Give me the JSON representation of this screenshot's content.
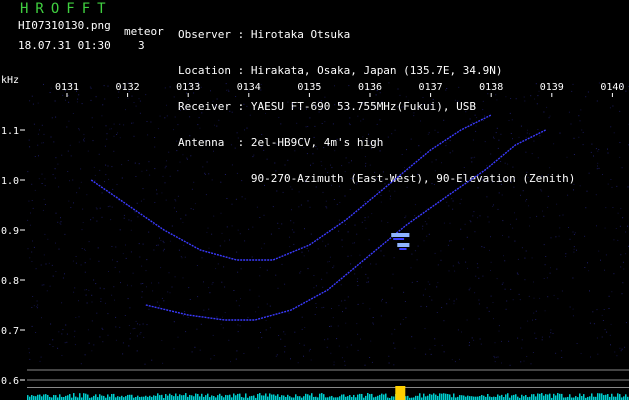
{
  "header": {
    "app_title": "HROFFT",
    "file_name": "HI07310130.png",
    "timestamp": "18.07.31 01:30",
    "meteor_label": "meteor",
    "meteor_count": "3",
    "info": [
      {
        "key": "Observer ",
        "value": "Hirotaka Otsuka"
      },
      {
        "key": "Location ",
        "value": "Hirakata, Osaka, Japan (135.7E, 34.9N)"
      },
      {
        "key": "Receiver ",
        "value": "YAESU FT-690 53.755MHz(Fukui), USB"
      },
      {
        "key": "Antenna  ",
        "value": "2el-HB9CV, 4m's high"
      },
      {
        "key": "",
        "value": "90-270-Azimuth (East-West), 90-Elevation (Zenith)"
      }
    ]
  },
  "colors": {
    "background": "#000000",
    "title": "#40d040",
    "signal": "#3a3aff",
    "signal_bright": "#8fb4ff",
    "noise_floor": "#00d0d0",
    "peak": "#ffd000",
    "grid_line": "#888888"
  },
  "chart_data": {
    "type": "heatmap",
    "ylabel": "kHz",
    "x_ticks": [
      "0131",
      "0132",
      "0133",
      "0134",
      "0135",
      "0136",
      "0137",
      "0138",
      "0139",
      "0140"
    ],
    "y_ticks": [
      "1.1",
      "1.0",
      "0.9",
      "0.8",
      "0.7",
      "0.6"
    ],
    "ylim": [
      0.58,
      1.15
    ],
    "xlim": [
      0,
      10
    ],
    "traces": [
      {
        "points": [
          [
            0.4,
            1.0
          ],
          [
            1.0,
            0.95
          ],
          [
            1.6,
            0.9
          ],
          [
            2.2,
            0.86
          ],
          [
            2.8,
            0.84
          ],
          [
            3.4,
            0.84
          ],
          [
            4.0,
            0.87
          ],
          [
            4.6,
            0.92
          ],
          [
            5.1,
            0.97
          ],
          [
            5.6,
            1.02
          ],
          [
            6.0,
            1.06
          ],
          [
            6.5,
            1.1
          ],
          [
            7.0,
            1.13
          ]
        ]
      },
      {
        "points": [
          [
            1.3,
            0.75
          ],
          [
            2.0,
            0.73
          ],
          [
            2.6,
            0.72
          ],
          [
            3.1,
            0.72
          ],
          [
            3.7,
            0.74
          ],
          [
            4.3,
            0.78
          ],
          [
            4.9,
            0.84
          ],
          [
            5.6,
            0.91
          ],
          [
            6.3,
            0.97
          ],
          [
            6.9,
            1.02
          ],
          [
            7.4,
            1.07
          ],
          [
            7.9,
            1.1
          ]
        ]
      }
    ],
    "meteor_echoes": [
      {
        "x": 5.5,
        "y": 0.89,
        "width": 0.3
      },
      {
        "x": 5.55,
        "y": 0.87,
        "width": 0.2
      }
    ],
    "reference_lines_khz": [
      0.62,
      0.6,
      0.585
    ]
  }
}
